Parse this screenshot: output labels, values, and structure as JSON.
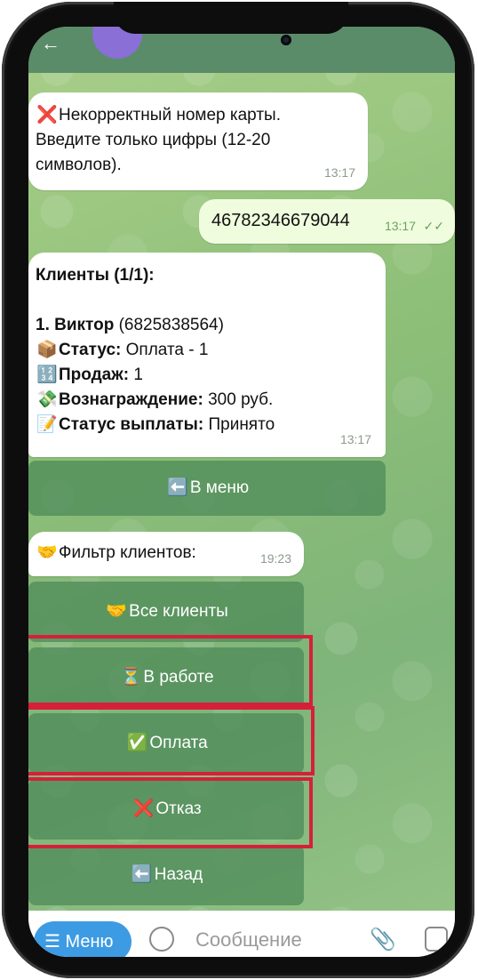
{
  "messages": {
    "error": {
      "icon": "❌",
      "line1": "Некорректный номер карты.",
      "line2": "Введите только цифры (12-20",
      "line3": "символов).",
      "time": "13:17"
    },
    "card": {
      "text": "46782346679044",
      "time": "13:17",
      "ticks": "✓✓"
    },
    "clients": {
      "heading": "Клиенты (1/1):",
      "name_bold": "1. Виктор",
      "name_rest": " (6825838564)",
      "status_icon": "📦",
      "status_label": "Статус:",
      "status_value": " Оплата - 1",
      "sales_icon": "🔢",
      "sales_label": "Продаж:",
      "sales_value": " 1",
      "reward_icon": "💸",
      "reward_label": "Вознаграждение:",
      "reward_value": " 300 руб.",
      "payout_icon": "📝",
      "payout_label": "Статус выплаты:",
      "payout_value": " Принято",
      "time": "13:17"
    },
    "menu_button": {
      "icon": "⬅️",
      "label": "В меню"
    },
    "filter": {
      "icon": "🤝",
      "label": "Фильтр клиентов:",
      "time": "19:23"
    }
  },
  "keyboard": {
    "all": {
      "icon": "🤝",
      "label": "Все клиенты"
    },
    "work": {
      "icon": "⏳",
      "label": "В работе"
    },
    "paid": {
      "icon": "✅",
      "label": "Оплата"
    },
    "fail": {
      "icon": "❌",
      "label": "Отказ"
    },
    "back": {
      "icon": "⬅️",
      "label": "Назад"
    }
  },
  "input": {
    "menu_label": "☰ Меню",
    "placeholder": "Сообщение"
  },
  "colors": {
    "highlight": "#d6203a",
    "chat_bg": "#8dbf78",
    "keyboard": "#508c5a"
  }
}
